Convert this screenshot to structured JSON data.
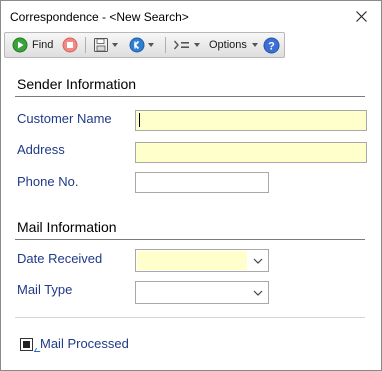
{
  "window": {
    "title": "Correspondence - <New Search>"
  },
  "toolbar": {
    "find_label": "Find",
    "options_label": "Options"
  },
  "sender": {
    "section_title": "Sender Information",
    "customer_name_label": "Customer Name",
    "customer_name_value": "",
    "address_label": "Address",
    "address_value": "",
    "phone_label": "Phone No.",
    "phone_value": ""
  },
  "mail": {
    "section_title": "Mail Information",
    "date_received_label": "Date Received",
    "date_received_value": "",
    "mail_type_label": "Mail Type",
    "mail_type_value": "",
    "processed_label": "Mail Processed",
    "processed_checked": true
  },
  "colors": {
    "label_blue": "#1f3a87",
    "required_field": "#ffffcc",
    "find_green": "#3aa23a",
    "stop_red": "#e0342b",
    "nav_blue": "#2d7fd3",
    "help_blue": "#3b6fd4"
  },
  "icons": {
    "find": "play-circle-icon",
    "stop": "stop-circle-icon",
    "save": "floppy-disk-icon",
    "back": "back-circle-icon",
    "insert": "insert-field-icon",
    "help": "help-circle-icon",
    "close": "close-icon",
    "dropdown": "chevron-down-icon"
  }
}
